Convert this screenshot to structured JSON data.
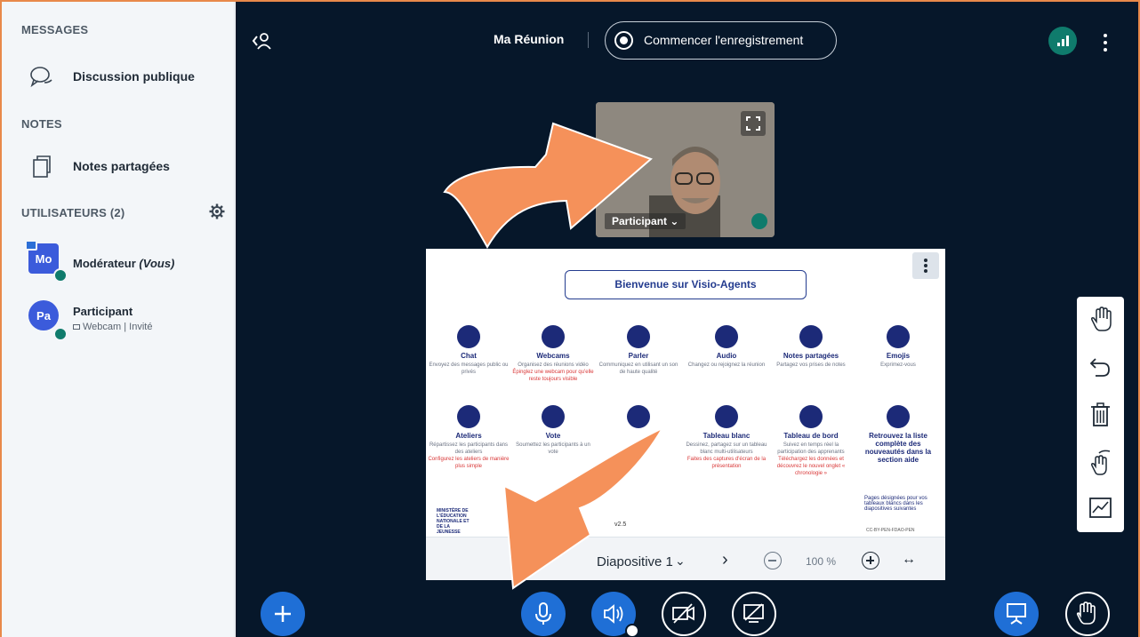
{
  "sidebar": {
    "messages_title": "MESSAGES",
    "public_chat_label": "Discussion publique",
    "notes_title": "NOTES",
    "shared_notes_label": "Notes partagées",
    "users_title": "UTILISATEURS (2)",
    "users": [
      {
        "initials": "Mo",
        "name": "Modérateur",
        "self_tag": "(Vous)",
        "sub": ""
      },
      {
        "initials": "Pa",
        "name": "Participant",
        "self_tag": "",
        "sub": "Webcam | Invité"
      }
    ]
  },
  "header": {
    "meeting_title": "Ma Réunion",
    "record_label": "Commencer l'enregistrement"
  },
  "video": {
    "participant_name": "Participant"
  },
  "slide": {
    "title": "Bienvenue sur Visio-Agents",
    "features_row1": [
      {
        "title": "Chat",
        "desc": "Envoyez des messages public ou privés",
        "note": ""
      },
      {
        "title": "Webcams",
        "desc": "Organisez des réunions vidéo",
        "note": "Épinglez une webcam pour qu'elle reste toujours visible"
      },
      {
        "title": "Parler",
        "desc": "Communiquez en utilisant un son de haute qualité",
        "note": ""
      },
      {
        "title": "Audio",
        "desc": "Changez ou rejoignez la réunion",
        "note": ""
      },
      {
        "title": "Notes partagées",
        "desc": "Partagez vos prises de notes",
        "note": ""
      },
      {
        "title": "Emojis",
        "desc": "Exprimez-vous",
        "note": ""
      }
    ],
    "features_row2": [
      {
        "title": "Ateliers",
        "desc": "Répartissez les participants dans des ateliers",
        "note": "Configurez les ateliers de manière plus simple"
      },
      {
        "title": "Vote",
        "desc": "Soumettez les participants à un vote",
        "note": ""
      },
      {
        "title": "",
        "desc": "",
        "note": ""
      },
      {
        "title": "Tableau blanc",
        "desc": "Dessinez, partagez sur un tableau blanc multi-utilisateurs",
        "note": "Faites des captures d'écran de la présentation"
      },
      {
        "title": "Tableau de bord",
        "desc": "Suivez en temps réel la participation des apprenants",
        "note": "Téléchargez les données et découvrez le nouvel onglet « chronologie »"
      },
      {
        "title": "Retrouvez la liste complète des nouveautés dans la section aide",
        "desc": "",
        "note": ""
      }
    ],
    "footer_version": "v2.5",
    "footer_right": "Pages désignées pour vos tableaux blancs dans les diapositives suivantes",
    "logo_text": "MINISTÈRE DE L'ÉDUCATION NATIONALE ET DE LA JEUNESSE",
    "license": "CC-BY-PEN-FDAO-PEN"
  },
  "slide_controls": {
    "slide_label": "Diapositive 1",
    "zoom": "100 %"
  },
  "colors": {
    "main_bg": "#06172a",
    "sidebar_bg": "#f3f6f9",
    "accent_blue": "#1f6fd6",
    "arrow_orange": "#f5915a",
    "connection_green": "#0f7b6c"
  }
}
